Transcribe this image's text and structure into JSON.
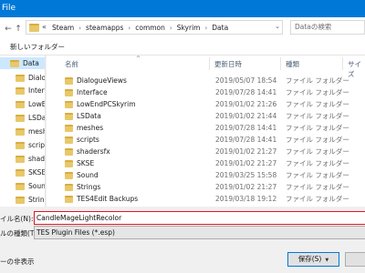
{
  "window": {
    "title": "File"
  },
  "address": {
    "overflow": "«",
    "crumbs": [
      "Steam",
      "steamapps",
      "common",
      "Skyrim",
      "Data"
    ],
    "search_placeholder": "Dataの検索"
  },
  "toolbar": {
    "new_folder": "新しいフォルダー"
  },
  "nav": {
    "items": [
      {
        "label": "Data",
        "selected": true
      },
      {
        "label": "Dialog",
        "selected": false
      },
      {
        "label": "Interfa",
        "selected": false
      },
      {
        "label": "LowEnd",
        "selected": false
      },
      {
        "label": "LSData",
        "selected": false
      },
      {
        "label": "meshe",
        "selected": false
      },
      {
        "label": "scripts",
        "selected": false
      },
      {
        "label": "shader",
        "selected": false
      },
      {
        "label": "SKSE",
        "selected": false
      },
      {
        "label": "Sound",
        "selected": false
      },
      {
        "label": "String",
        "selected": false
      }
    ]
  },
  "columns": {
    "name": "名前",
    "date": "更新日時",
    "type": "種類",
    "size": "サイズ"
  },
  "files": [
    {
      "name": "DialogueViews",
      "date": "2019/05/07 18:54",
      "type": "ファイル フォルダー"
    },
    {
      "name": "Interface",
      "date": "2019/07/28 14:41",
      "type": "ファイル フォルダー"
    },
    {
      "name": "LowEndPCSkyrim",
      "date": "2019/01/02 21:26",
      "type": "ファイル フォルダー"
    },
    {
      "name": "LSData",
      "date": "2019/01/02 21:44",
      "type": "ファイル フォルダー"
    },
    {
      "name": "meshes",
      "date": "2019/07/28 14:41",
      "type": "ファイル フォルダー"
    },
    {
      "name": "scripts",
      "date": "2019/07/28 14:41",
      "type": "ファイル フォルダー"
    },
    {
      "name": "shadersfx",
      "date": "2019/01/02 21:27",
      "type": "ファイル フォルダー"
    },
    {
      "name": "SKSE",
      "date": "2019/01/02 21:27",
      "type": "ファイル フォルダー"
    },
    {
      "name": "Sound",
      "date": "2019/03/25 15:58",
      "type": "ファイル フォルダー"
    },
    {
      "name": "Strings",
      "date": "2019/01/02 21:27",
      "type": "ファイル フォルダー"
    },
    {
      "name": "TES4Edit Backups",
      "date": "2019/03/18 19:12",
      "type": "ファイル フォルダー"
    }
  ],
  "form": {
    "filename_label": "イル名(N):",
    "filename_value": "CandleMageLightRecolor",
    "filetype_label": "ルの種類(T):",
    "filetype_value": "TES Plugin Files (*.esp)",
    "hide_folders": "ーの非表示",
    "save_label": "保存(S)"
  },
  "colors": {
    "accent": "#0078d7",
    "selection": "#cce8ff",
    "error_border": "#e81123"
  }
}
